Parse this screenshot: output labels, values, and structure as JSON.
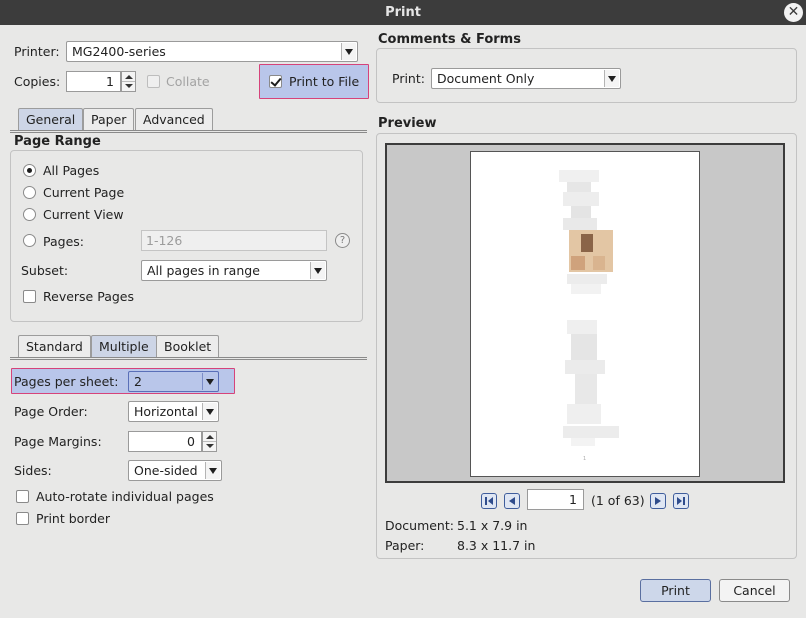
{
  "window": {
    "title": "Print"
  },
  "printer": {
    "label": "Printer:",
    "value": "MG2400-series"
  },
  "copies": {
    "label": "Copies:",
    "value": "1",
    "collate_label": "Collate",
    "print_to_file_label": "Print to File"
  },
  "tabs_main": [
    "General",
    "Paper",
    "Advanced"
  ],
  "page_range": {
    "heading": "Page Range",
    "all_pages": "All Pages",
    "current_page": "Current Page",
    "current_view": "Current View",
    "pages_label": "Pages:",
    "pages_placeholder": "1-126",
    "help": "?",
    "subset_label": "Subset:",
    "subset_value": "All pages in range",
    "reverse_label": "Reverse Pages"
  },
  "tabs_layout": [
    "Standard",
    "Multiple",
    "Booklet"
  ],
  "layout": {
    "pps_label": "Pages per sheet:",
    "pps_value": "2",
    "order_label": "Page Order:",
    "order_value": "Horizontal",
    "margins_label": "Page Margins:",
    "margins_value": "0",
    "sides_label": "Sides:",
    "sides_value": "One-sided",
    "autorotate_label": "Auto-rotate individual pages",
    "border_label": "Print border"
  },
  "comments": {
    "heading": "Comments & Forms",
    "print_label": "Print:",
    "print_value": "Document Only"
  },
  "preview": {
    "heading": "Preview",
    "page_value": "1",
    "page_count": "(1 of 63)",
    "document_label": "Document:",
    "document_value": "5.1 x 7.9 in",
    "paper_label": "Paper:",
    "paper_value": "8.3 x 11.7 in",
    "page_footer": "1"
  },
  "buttons": {
    "print": "Print",
    "cancel": "Cancel"
  },
  "colors": {
    "highlight": "#b9c6ea",
    "highlight_border": "#d6437a",
    "titlebar": "#3c3c3c"
  }
}
